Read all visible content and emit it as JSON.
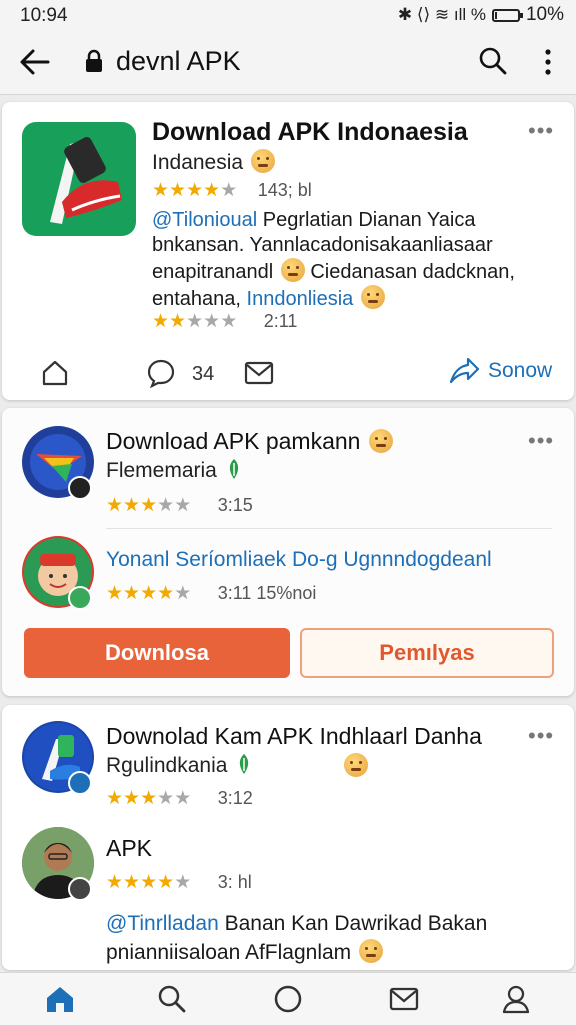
{
  "status_bar": {
    "time": "10:94",
    "icons_text": "✱ ⟨⟩ ≋ ıll %",
    "battery": "10%",
    "battery_level": 0.1
  },
  "app_bar": {
    "title": "devnl APK"
  },
  "card1": {
    "title": "Download APK Indonaesia",
    "subtitle": "Indanesia",
    "rating": 3.5,
    "meta": "143; bl",
    "body_link": "@Tilonioual",
    "body_1": " Pegrlatian Dianan Yaica bnkansan. Yannlacadonisakaanliasaar enapitranandl",
    "body_2": " Ciedanasan dadcknan, entahana, ",
    "body_link2": "Inndonliesia",
    "rating2": 1.5,
    "time": "2:11",
    "comments": "34",
    "action": "Sonow"
  },
  "card2": {
    "title": "Download APK pamkann",
    "subtitle": "Flememaria",
    "rating": 2.5,
    "time": "3:15",
    "item_title": "Yonanl Seríomliaek Do-g Ugnnndogdeanl",
    "item_rating": 3.5,
    "item_meta": "3:11 15%noi",
    "primary_button": "Downlosa",
    "secondary_button": "Pemılyas"
  },
  "card3": {
    "title": "Downolad Kam APK Indhlaarl Danha",
    "subtitle": "Rgulindkania",
    "rating": 3,
    "time": "3:12",
    "item_title": "APK",
    "item_rating": 3.5,
    "item_meta": "3: hl",
    "body_link": "@Tinrlladan",
    "body_1": " Banan Kan Dawrikad Bakan pnianniisaloan AfFlagnlam"
  },
  "bottom_nav": [
    "home-icon",
    "search-icon",
    "circle-icon",
    "mail-icon",
    "profile-icon"
  ],
  "colors": {
    "accent": "#1d6fb8",
    "primary_button": "#e8623a",
    "star": "#f2a900"
  }
}
